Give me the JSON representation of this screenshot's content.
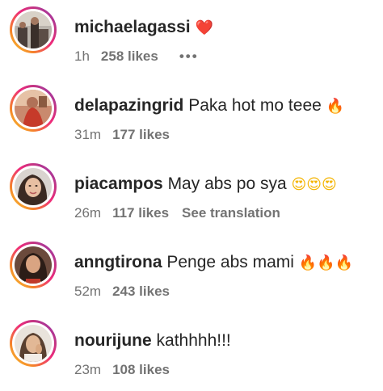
{
  "comments": [
    {
      "username": "michaelagassi",
      "text": "",
      "emoji": "❤️",
      "time": "1h",
      "likes": "258 likes",
      "more": "•••"
    },
    {
      "username": "delapazingrid",
      "text": "Paka hot mo teee",
      "emoji": "🔥",
      "time": "31m",
      "likes": "177 likes"
    },
    {
      "username": "piacampos",
      "text": "May abs po sya",
      "emoji": "😍😍😍",
      "time": "26m",
      "likes": "117 likes",
      "see_translation": "See translation"
    },
    {
      "username": "anngtirona",
      "text": "Penge abs mami",
      "emoji": "🔥🔥🔥",
      "time": "52m",
      "likes": "243 likes"
    },
    {
      "username": "nourijune",
      "text": "kathhhh!!!",
      "emoji": "",
      "time": "23m",
      "likes": "108 likes"
    }
  ],
  "colors": {
    "text": "#262626",
    "secondary": "#737373",
    "heart": "#ed1c24"
  }
}
